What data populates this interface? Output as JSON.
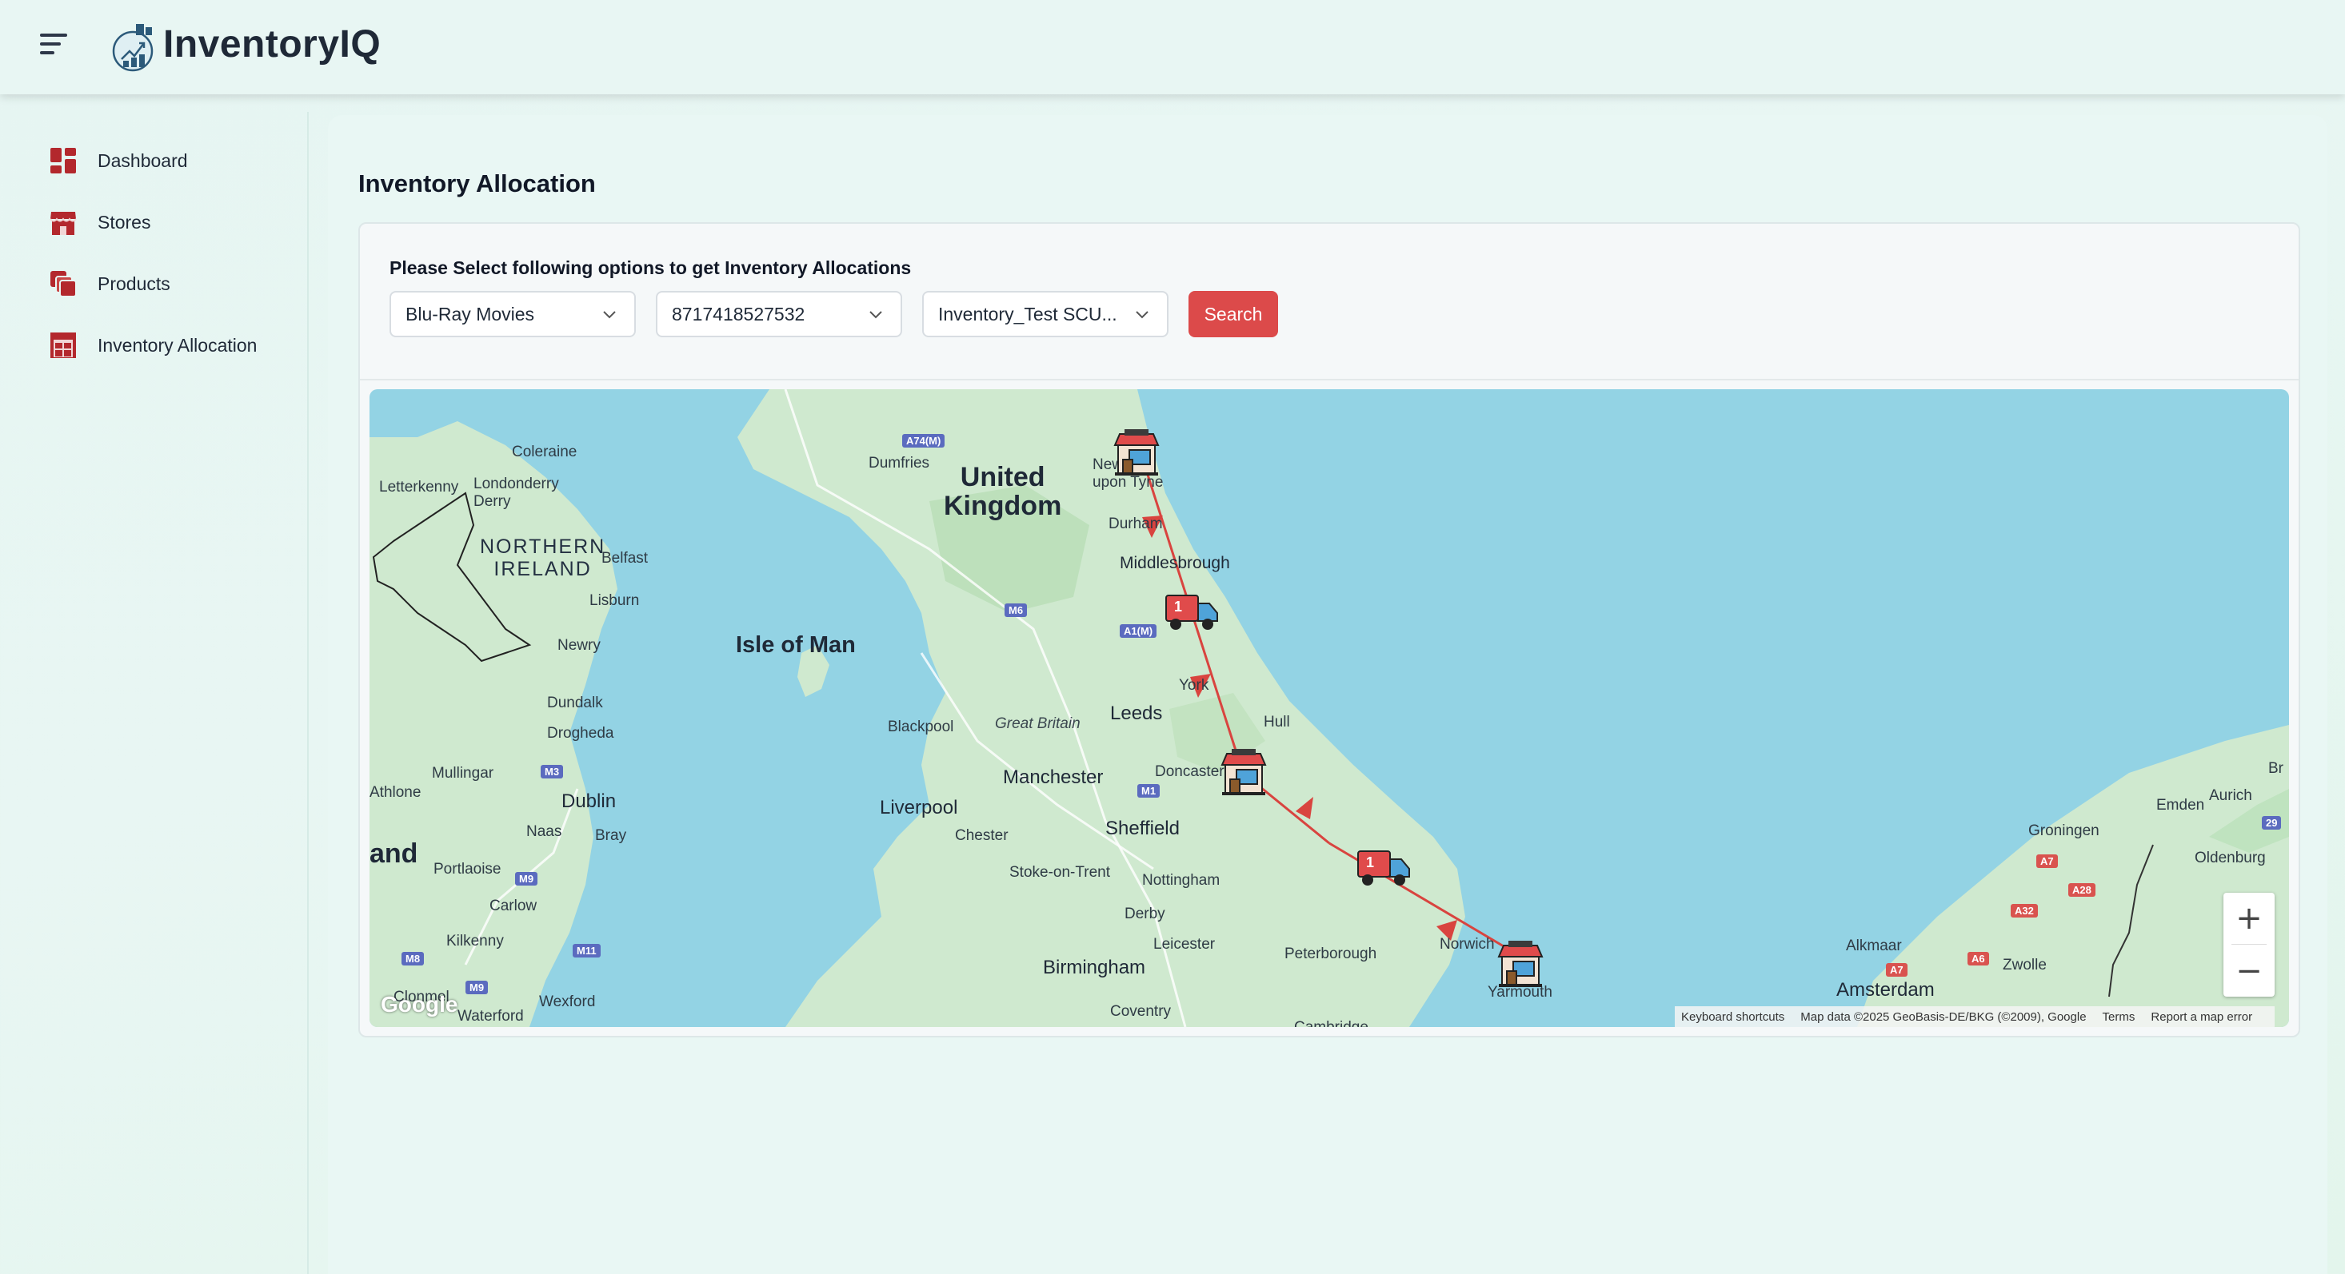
{
  "app": {
    "name": "InventoryIQ"
  },
  "sidebar": {
    "items": [
      {
        "label": "Dashboard",
        "icon": "dashboard-icon"
      },
      {
        "label": "Stores",
        "icon": "store-icon"
      },
      {
        "label": "Products",
        "icon": "products-icon"
      },
      {
        "label": "Inventory Allocation",
        "icon": "warehouse-icon"
      }
    ]
  },
  "page": {
    "title": "Inventory Allocation",
    "instruction": "Please Select following options to get Inventory Allocations"
  },
  "filters": {
    "category": "Blu-Ray Movies",
    "product": "8717418527532",
    "scenario": "Inventory_Test SCU...",
    "search_label": "Search"
  },
  "map": {
    "labels": {
      "coleraine": "Coleraine",
      "londonderry": "Londonderry\nDerry",
      "letterkenny": "Letterkenny",
      "northern_ireland": "NORTHERN\nIRELAND",
      "belfast": "Belfast",
      "lisburn": "Lisburn",
      "newry": "Newry",
      "dundalk": "Dundalk",
      "drogheda": "Drogheda",
      "mullingar": "Mullingar",
      "dublin": "Dublin",
      "athlone": "Athlone",
      "naas": "Naas",
      "bray": "Bray",
      "ireland": "and",
      "portlaoise": "Portlaoise",
      "carlow": "Carlow",
      "kilkenny": "Kilkenny",
      "clonmel": "Clonmel",
      "waterford": "Waterford",
      "wexford": "Wexford",
      "isle_of_man": "Isle of Man",
      "dumfries": "Dumfries",
      "united_kingdom": "United\nKingdom",
      "newcastle": "New   le\nupon Tyne",
      "durham": "Durham",
      "middlesbrough": "Middlesbrough",
      "york": "York",
      "leeds": "Leeds",
      "hull": "Hull",
      "blackpool": "Blackpool",
      "great_britain": "Great Britain",
      "manchester": "Manchester",
      "doncaster": "Doncaster",
      "liverpool": "Liverpool",
      "sheffield": "Sheffield",
      "chester": "Chester",
      "stoke": "Stoke-on-Trent",
      "nottingham": "Nottingham",
      "derby": "Derby",
      "leicester": "Leicester",
      "peterborough": "Peterborough",
      "birmingham": "Birmingham",
      "coventry": "Coventry",
      "cambridge": "Cambridge",
      "norwich": "Norwich",
      "yarmouth": "Yarmouth",
      "amsterdam": "Amsterdam",
      "alkmaar": "Alkmaar",
      "zwolle": "Zwolle",
      "groningen": "Groningen",
      "emden": "Emden",
      "aurich": "Aurich",
      "oldenburg": "Oldenburg",
      "br": "Br"
    },
    "shields": {
      "a74m": "A74(M)",
      "m6": "M6",
      "a1m": "A1(M)",
      "m1": "M1",
      "m3": "M3",
      "m9a": "M9",
      "m9b": "M9",
      "m11": "M11",
      "m8": "M8",
      "a7a": "A7",
      "a7b": "A7",
      "a28": "A28",
      "a32": "A32",
      "a6": "A6",
      "n29": "29"
    },
    "truck_badges": [
      "1",
      "1"
    ],
    "zoom_in": "+",
    "zoom_out": "−",
    "google": "Google",
    "attribution": {
      "shortcuts": "Keyboard shortcuts",
      "data": "Map data ©2025 GeoBasis-DE/BKG (©2009), Google",
      "terms": "Terms",
      "report": "Report a map error"
    }
  },
  "colors": {
    "accent": "#dc4a4a",
    "icon": "#b3282d",
    "route": "#d9443f",
    "sea": "#93d3e4",
    "land": "#cfe9cf"
  }
}
